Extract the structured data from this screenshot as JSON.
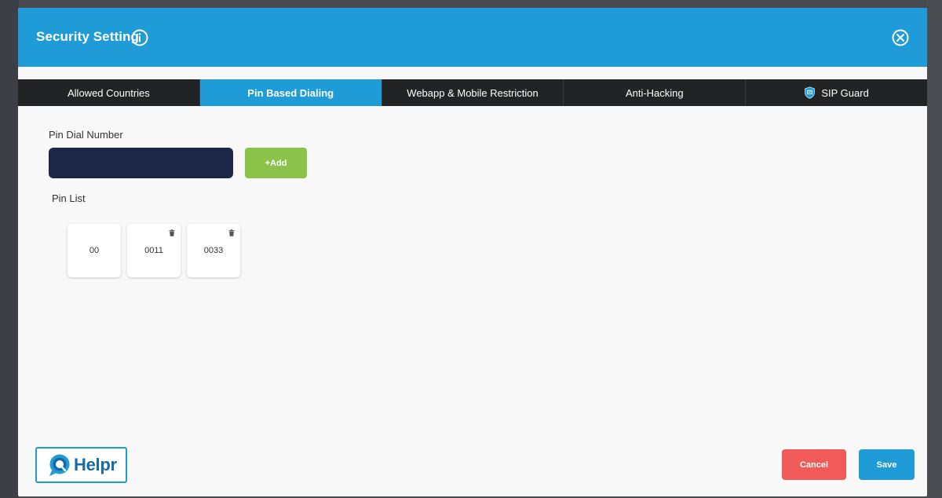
{
  "modal": {
    "title": "Security Setting",
    "info_icon": "info-icon",
    "close_icon": "close-icon"
  },
  "tabs": [
    {
      "label": "Allowed Countries",
      "active": false
    },
    {
      "label": "Pin Based Dialing",
      "active": true
    },
    {
      "label": "Webapp & Mobile Restriction",
      "active": false
    },
    {
      "label": "Anti-Hacking",
      "active": false
    },
    {
      "label": "SIP Guard",
      "active": false,
      "icon": "shield-icon"
    }
  ],
  "pin_form": {
    "label": "Pin Dial Number",
    "value": "",
    "placeholder": "",
    "add_label": "+Add"
  },
  "pin_list": {
    "label": "Pin List",
    "items": [
      {
        "value": "00",
        "deletable": false
      },
      {
        "value": "0011",
        "deletable": true
      },
      {
        "value": "0033",
        "deletable": true
      }
    ]
  },
  "footer": {
    "brand": "Helpr",
    "cancel_label": "Cancel",
    "save_label": "Save"
  },
  "colors": {
    "header": "#1f9bd7",
    "tab_inactive": "#222325",
    "tab_active": "#1f9bd7",
    "input_bg": "#1c2748",
    "add": "#8bc34a",
    "cancel": "#f25a5a",
    "save": "#1f9bd7"
  }
}
